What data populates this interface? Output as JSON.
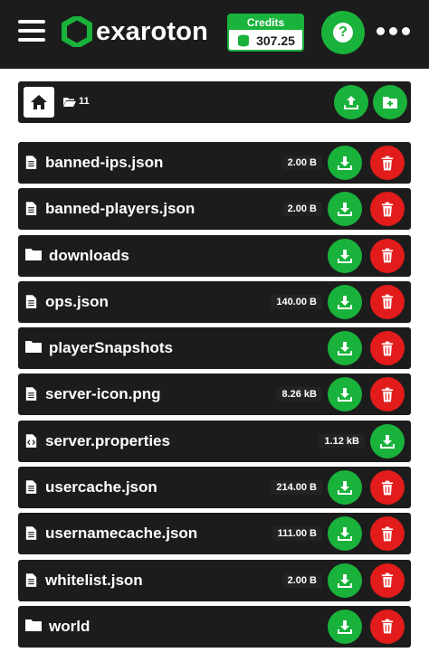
{
  "header": {
    "logo_text": "exaroton",
    "credits_label": "Credits",
    "credits_value": "307.25",
    "help_symbol": "?"
  },
  "pathbar": {
    "path_label": "11"
  },
  "files": [
    {
      "name": "banned-ips.json",
      "type": "file",
      "icon": "file-icon",
      "size": "2.00 B",
      "deletable": true
    },
    {
      "name": "banned-players.json",
      "type": "file",
      "icon": "file-icon",
      "size": "2.00 B",
      "deletable": true
    },
    {
      "name": "downloads",
      "type": "folder",
      "icon": "folder-icon",
      "size": "",
      "deletable": true
    },
    {
      "name": "ops.json",
      "type": "file",
      "icon": "file-icon",
      "size": "140.00 B",
      "deletable": true
    },
    {
      "name": "playerSnapshots",
      "type": "folder",
      "icon": "folder-icon",
      "size": "",
      "deletable": true
    },
    {
      "name": "server-icon.png",
      "type": "file",
      "icon": "file-icon",
      "size": "8.26 kB",
      "deletable": true
    },
    {
      "name": "server.properties",
      "type": "file",
      "icon": "code-file-icon",
      "size": "1.12 kB",
      "deletable": false
    },
    {
      "name": "usercache.json",
      "type": "file",
      "icon": "file-icon",
      "size": "214.00 B",
      "deletable": true
    },
    {
      "name": "usernamecache.json",
      "type": "file",
      "icon": "file-icon",
      "size": "111.00 B",
      "deletable": true
    },
    {
      "name": "whitelist.json",
      "type": "file",
      "icon": "file-icon",
      "size": "2.00 B",
      "deletable": true
    },
    {
      "name": "world",
      "type": "folder",
      "icon": "folder-icon",
      "size": "",
      "deletable": true
    }
  ],
  "colors": {
    "accent_green": "#19b23b",
    "danger_red": "#e21b1b",
    "panel_dark": "#1c1c1c"
  }
}
